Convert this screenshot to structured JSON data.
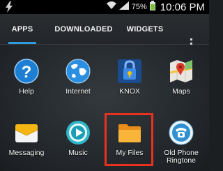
{
  "status_bar": {
    "battery_percent": "75%",
    "time": "10:06 PM"
  },
  "tabs": [
    {
      "label": "APPS",
      "selected": true
    },
    {
      "label": "DOWNLOADED",
      "selected": false
    },
    {
      "label": "WIDGETS",
      "selected": false
    }
  ],
  "apps": [
    {
      "label": "Help",
      "icon": "help-icon"
    },
    {
      "label": "Internet",
      "icon": "globe-icon"
    },
    {
      "label": "KNOX",
      "icon": "knox-lock-icon"
    },
    {
      "label": "Maps",
      "icon": "maps-icon"
    },
    {
      "label": "Messaging",
      "icon": "envelope-icon"
    },
    {
      "label": "Music",
      "icon": "music-icon"
    },
    {
      "label": "My Files",
      "icon": "folder-icon"
    },
    {
      "label": "Old Phone Ringtone",
      "label_line1": "Old Phone",
      "label_line2": "Ringtone",
      "icon": "phone-icon"
    }
  ],
  "highlighted_app": "My Files",
  "colors": {
    "tab_indicator": "#2f9be0",
    "highlight_border": "#e8321f",
    "battery": "#7ec13d"
  }
}
